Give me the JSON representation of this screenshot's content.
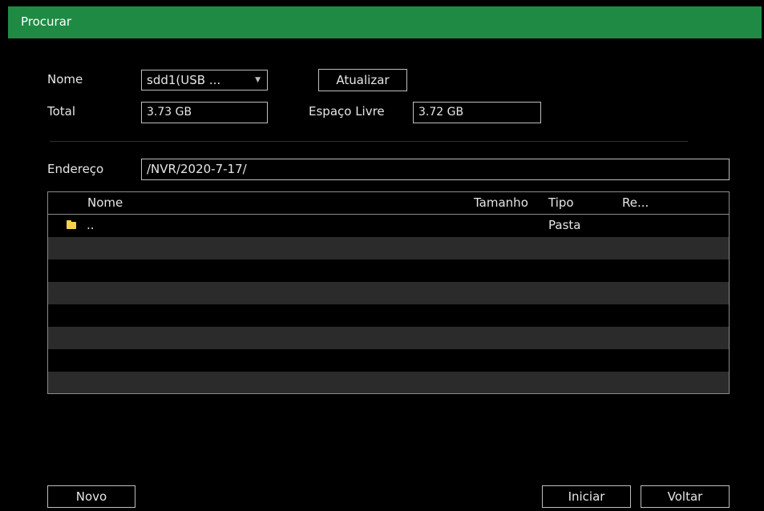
{
  "window": {
    "title": "Procurar"
  },
  "form": {
    "nome_label": "Nome",
    "nome_value": "sdd1(USB ...",
    "atualizar_label": "Atualizar",
    "total_label": "Total",
    "total_value": "3.73 GB",
    "espaco_livre_label": "Espaço Livre",
    "espaco_livre_value": "3.72 GB",
    "endereco_label": "Endereço",
    "endereco_value": "/NVR/2020-7-17/"
  },
  "table": {
    "columns": [
      "Nome",
      "Tamanho",
      "Tipo",
      "Re..."
    ],
    "rows": [
      {
        "name": "..",
        "size": "",
        "type": "Pasta",
        "re": ""
      }
    ]
  },
  "footer": {
    "novo_label": "Novo",
    "iniciar_label": "Iniciar",
    "voltar_label": "Voltar"
  },
  "icons": {
    "dropdown": "chevron-down-icon",
    "folder": "folder-icon"
  },
  "colors": {
    "titlebar": "#1f8a43",
    "folder": "#f2d34a",
    "alt_row": "#2b2b2b"
  }
}
